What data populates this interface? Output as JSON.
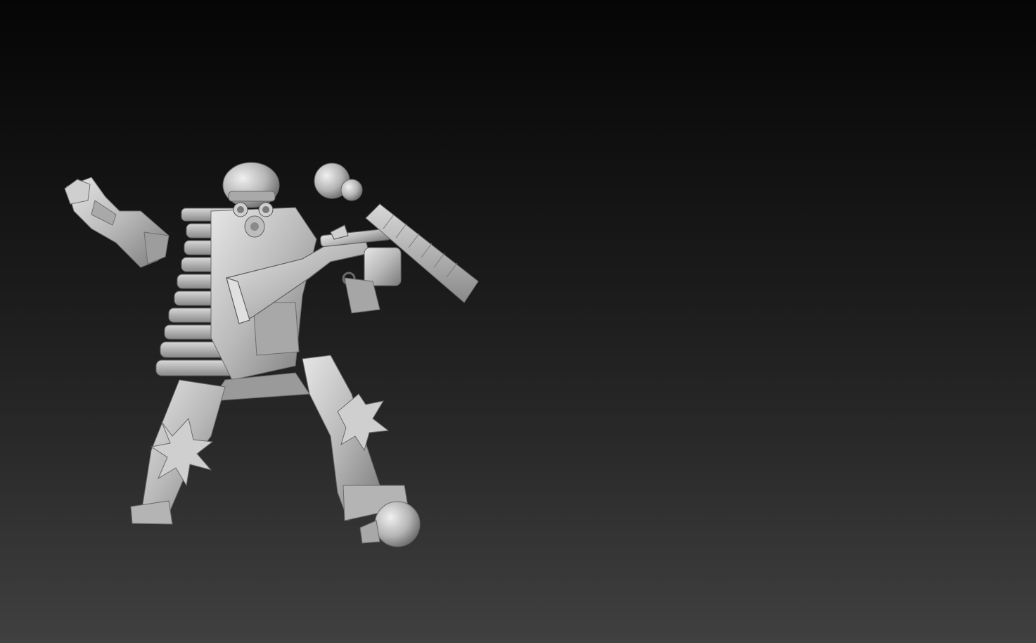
{
  "viewport": {
    "background_top": "#050505",
    "background_bottom": "#404040",
    "model_color": "#bdbdbd",
    "model_name_icon": "armored-soldier-sculpt"
  }
}
